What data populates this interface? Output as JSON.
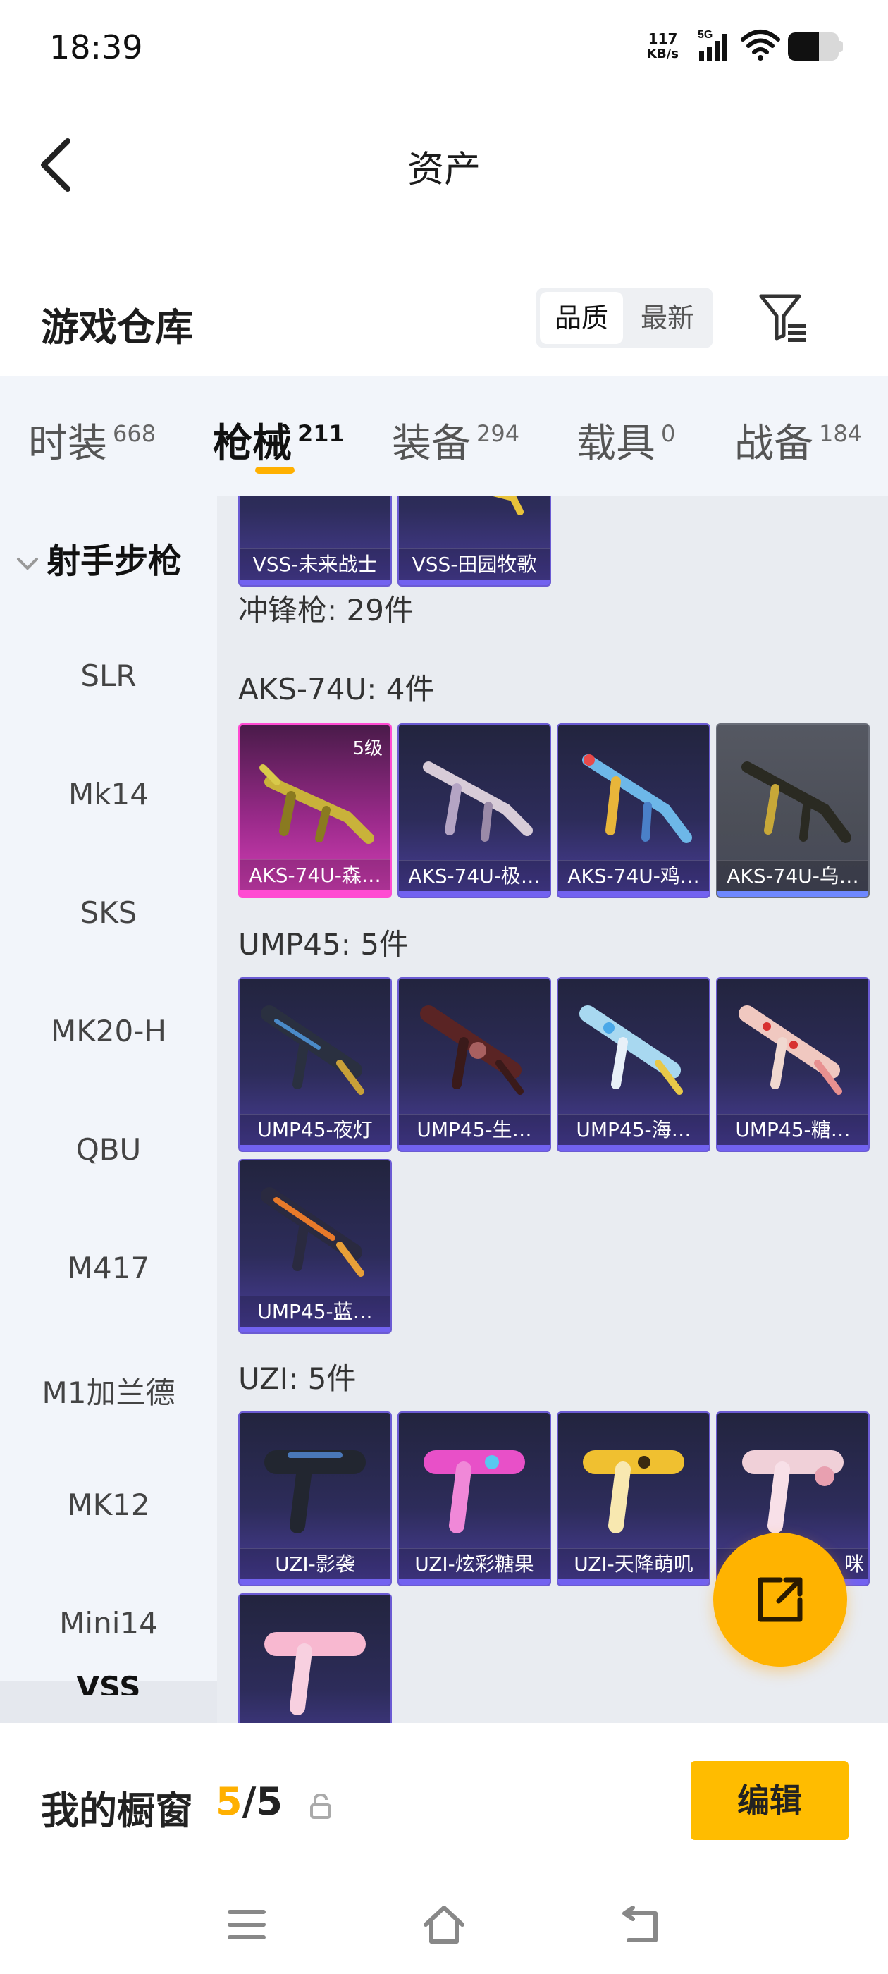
{
  "status_bar": {
    "time": "18:39",
    "net_speed": "117",
    "net_unit": "KB/s",
    "network": "5G"
  },
  "header": {
    "title": "资产"
  },
  "warehouse": {
    "title": "游戏仓库",
    "sort_options": [
      "品质",
      "最新"
    ],
    "active_sort": "品质"
  },
  "tabs": [
    {
      "label": "时装",
      "count": "668"
    },
    {
      "label": "枪械",
      "count": "211"
    },
    {
      "label": "装备",
      "count": "294"
    },
    {
      "label": "载具",
      "count": "0"
    },
    {
      "label": "战备",
      "count": "184"
    }
  ],
  "active_tab": "枪械",
  "sidebar": {
    "group": "射手步枪",
    "items": [
      "SLR",
      "Mk14",
      "SKS",
      "MK20-H",
      "QBU",
      "M417",
      "M1加兰德",
      "MK12",
      "Mini14"
    ],
    "partial_item": "VSS"
  },
  "main": {
    "top_partial_cards": [
      "VSS-未来战士",
      "VSS-田园牧歌"
    ],
    "category_title": "冲锋枪: 29件",
    "sections": [
      {
        "title": "AKS-74U: 4件",
        "cards": [
          {
            "label": "AKS-74U-森…",
            "level": "5级",
            "rarity": "pink"
          },
          {
            "label": "AKS-74U-极…",
            "rarity": "purple"
          },
          {
            "label": "AKS-74U-鸡…",
            "rarity": "purple"
          },
          {
            "label": "AKS-74U-乌…",
            "rarity": "gray"
          }
        ]
      },
      {
        "title": "UMP45: 5件",
        "cards": [
          {
            "label": "UMP45-夜灯",
            "rarity": "purple"
          },
          {
            "label": "UMP45-生…",
            "rarity": "purple"
          },
          {
            "label": "UMP45-海…",
            "rarity": "purple"
          },
          {
            "label": "UMP45-糖…",
            "rarity": "purple"
          },
          {
            "label": "UMP45-蓝…",
            "rarity": "purple"
          }
        ]
      },
      {
        "title": "UZI: 5件",
        "cards": [
          {
            "label": "UZI-影袭",
            "rarity": "purple"
          },
          {
            "label": "UZI-炫彩糖果",
            "rarity": "purple"
          },
          {
            "label": "UZI-天降萌叽",
            "rarity": "purple"
          },
          {
            "label": "咪",
            "rarity": "purple"
          },
          {
            "label": "",
            "rarity": "purple"
          }
        ]
      }
    ]
  },
  "showcase": {
    "label": "我的橱窗",
    "current": "5",
    "separator": "/",
    "total": "5",
    "edit_label": "编辑"
  },
  "colors": {
    "accent": "#ffb000",
    "card_purple": "#6b5bd3",
    "card_pink": "#ff4bd2",
    "panel_bg": "#e9ecf1",
    "sidebar_bg": "#f2f5fa"
  },
  "icons": {
    "back": "back-arrow-icon",
    "filter": "filter-icon",
    "share": "share-icon",
    "lock": "lock-icon",
    "nav_menu": "menu-icon",
    "nav_home": "home-icon",
    "nav_back": "back-icon"
  }
}
